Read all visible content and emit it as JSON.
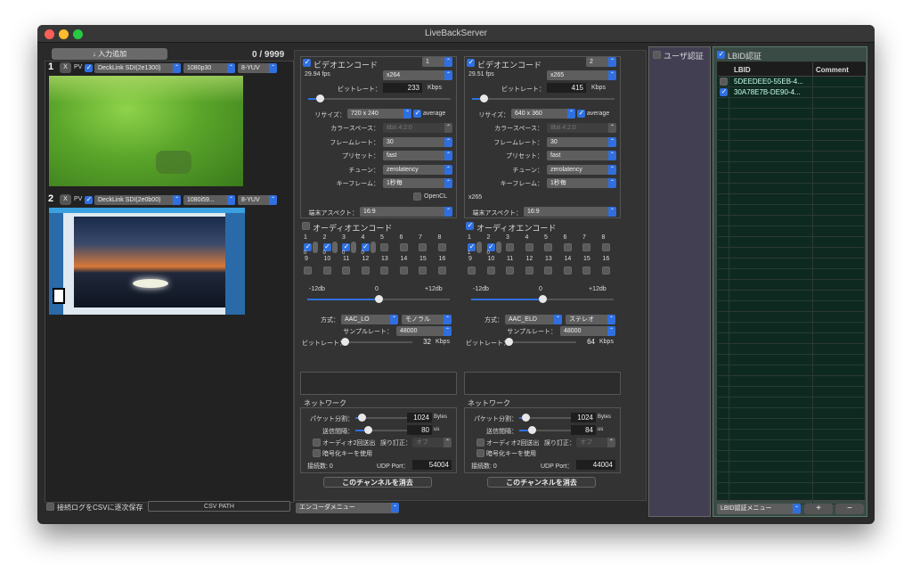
{
  "window": {
    "title": "LiveBackServer"
  },
  "inputs": {
    "add_label": "↓ 入力追加",
    "count": "0 / 9999",
    "items": [
      {
        "num": "1",
        "x": "X",
        "pv": "PV",
        "device": "DeckLink SDI(2e1300)",
        "format": "1080p30",
        "pixel": "8-YUV"
      },
      {
        "num": "2",
        "x": "X",
        "pv": "PV",
        "device": "DeckLink SDI(2e0b00)",
        "format": "1080i59...",
        "pixel": "8-YUV"
      }
    ],
    "csv_save_label": "接続ログをCSVに逐次保存",
    "csv_path": "CSV PATH"
  },
  "encoders": [
    {
      "video_label": "ビデオエンコード",
      "channel": "1",
      "fps": "29.94 fps",
      "codec": "x264",
      "bitrate_label": "ビットレート：",
      "bitrate": "233",
      "bitrate_unit": "Kbps",
      "resize_label": "リサイズ：",
      "resize": "720 x 240",
      "average": "average",
      "colorspace_label": "カラースペース：",
      "colorspace": "8bit 4:2:0",
      "framerate_label": "フレームレート：",
      "framerate": "30",
      "preset_label": "プリセット：",
      "preset": "fast",
      "tune_label": "チューン：",
      "tune": "zerolatency",
      "keyframe_label": "キーフレーム：",
      "keyframe": "1秒毎",
      "opencl": "OpenCL",
      "extra_label": "",
      "aspect_label": "端末アスペクト：",
      "aspect": "16:9",
      "audio_label": "オーディオエンコード",
      "ch_top": [
        "1",
        "2",
        "3",
        "4",
        "5",
        "6",
        "7",
        "8"
      ],
      "ch_bottom": [
        "9",
        "10",
        "11",
        "12",
        "13",
        "14",
        "15",
        "16"
      ],
      "ch_zero": [
        "0",
        "0",
        "0",
        "0"
      ],
      "db_min": "-12db",
      "db_mid": "0",
      "db_max": "+12db",
      "method_label": "方式：",
      "method": "AAC_LO",
      "channels": "モノラル",
      "samplerate_label": "サンプルレート：",
      "samplerate": "48000",
      "abitrate_label": "ビットレート：",
      "abitrate": "32",
      "abitrate_unit": "Kbps",
      "network_label": "ネットワーク",
      "packet_label": "パケット分割：",
      "packet": "1024",
      "packet_unit": "Bytes",
      "interval_label": "送信間隔：",
      "interval": "80",
      "interval_unit": "us",
      "audio_twice": "オーディオ2回送出",
      "fec_label": "誤り訂正：",
      "fec": "オフ",
      "encrypt": "暗号化キーを使用",
      "connections": "接続数: 0",
      "udp_label": "UDP Port：",
      "udp": "54004",
      "delete": "このチャンネルを消去"
    },
    {
      "video_label": "ビデオエンコード",
      "channel": "2",
      "fps": "29.51 fps",
      "codec": "x265",
      "bitrate_label": "ビットレート：",
      "bitrate": "415",
      "bitrate_unit": "Kbps",
      "resize_label": "リサイズ：",
      "resize": "640 x 360",
      "average": "average",
      "colorspace_label": "カラースペース：",
      "colorspace": "8bit 4:2:0",
      "framerate_label": "フレームレート：",
      "framerate": "30",
      "preset_label": "プリセット：",
      "preset": "fast",
      "tune_label": "チューン：",
      "tune": "zerolatency",
      "keyframe_label": "キーフレーム：",
      "keyframe": "1秒毎",
      "opencl": "",
      "extra_label": "x265",
      "aspect_label": "端末アスペクト：",
      "aspect": "16:9",
      "audio_label": "オーディオエンコード",
      "ch_top": [
        "1",
        "2",
        "3",
        "4",
        "5",
        "6",
        "7",
        "8"
      ],
      "ch_bottom": [
        "9",
        "10",
        "11",
        "12",
        "13",
        "14",
        "15",
        "16"
      ],
      "ch_zero": [
        "1",
        "0"
      ],
      "db_min": "-12db",
      "db_mid": "0",
      "db_max": "+12db",
      "method_label": "方式：",
      "method": "AAC_ELD",
      "channels": "ステレオ",
      "samplerate_label": "サンプルレート：",
      "samplerate": "48000",
      "abitrate_label": "ビットレート：",
      "abitrate": "64",
      "abitrate_unit": "Kbps",
      "network_label": "ネットワーク",
      "packet_label": "パケット分割：",
      "packet": "1024",
      "packet_unit": "Bytes",
      "interval_label": "送信間隔：",
      "interval": "84",
      "interval_unit": "us",
      "audio_twice": "オーディオ2回送出",
      "fec_label": "誤り訂正：",
      "fec": "オフ",
      "encrypt": "暗号化キーを使用",
      "connections": "接続数: 0",
      "udp_label": "UDP Port：",
      "udp": "44004",
      "delete": "このチャンネルを消去"
    }
  ],
  "encoder_menu": "エンコーダメニュー",
  "user_auth": {
    "label": "ユーザ認証"
  },
  "lbid": {
    "label": "LBID認証",
    "col_lbid": "LBID",
    "col_comment": "Comment",
    "rows": [
      {
        "id": "5DEEDEE0-55EB-4...",
        "checked": false
      },
      {
        "id": "30A78E7B-DE90-4...",
        "checked": true
      }
    ],
    "menu": "LBID認証メニュー",
    "add": "+",
    "remove": "−"
  },
  "colors": {
    "accent": "#2f6fe0",
    "grid": "#0e2a20"
  }
}
